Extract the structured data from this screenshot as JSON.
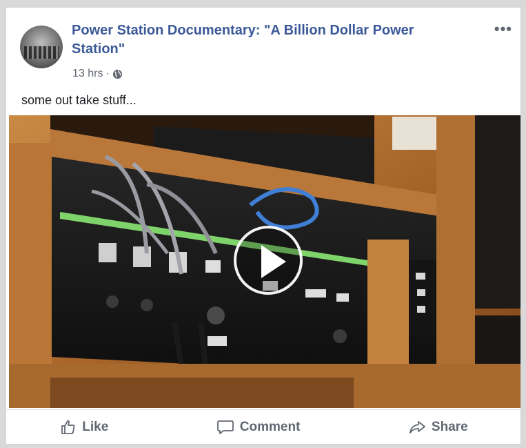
{
  "post": {
    "page_name": "Power Station Documentary: \"A Billion Dollar Power Station\"",
    "time": "13 hrs",
    "separator": "·",
    "body": "some out take stuff..."
  },
  "video": {
    "thumbnail": "recording studio patch bay with cables",
    "overlay_icon": "play-icon"
  },
  "actions": [
    {
      "label": "Like",
      "icon": "thumbs-up-icon"
    },
    {
      "label": "Comment",
      "icon": "comment-icon"
    },
    {
      "label": "Share",
      "icon": "share-icon"
    }
  ],
  "icons": {
    "more": "more-options-icon",
    "privacy": "globe-icon"
  },
  "colors": {
    "link": "#3b5998",
    "meta": "#606770",
    "text": "#1c1e21"
  }
}
